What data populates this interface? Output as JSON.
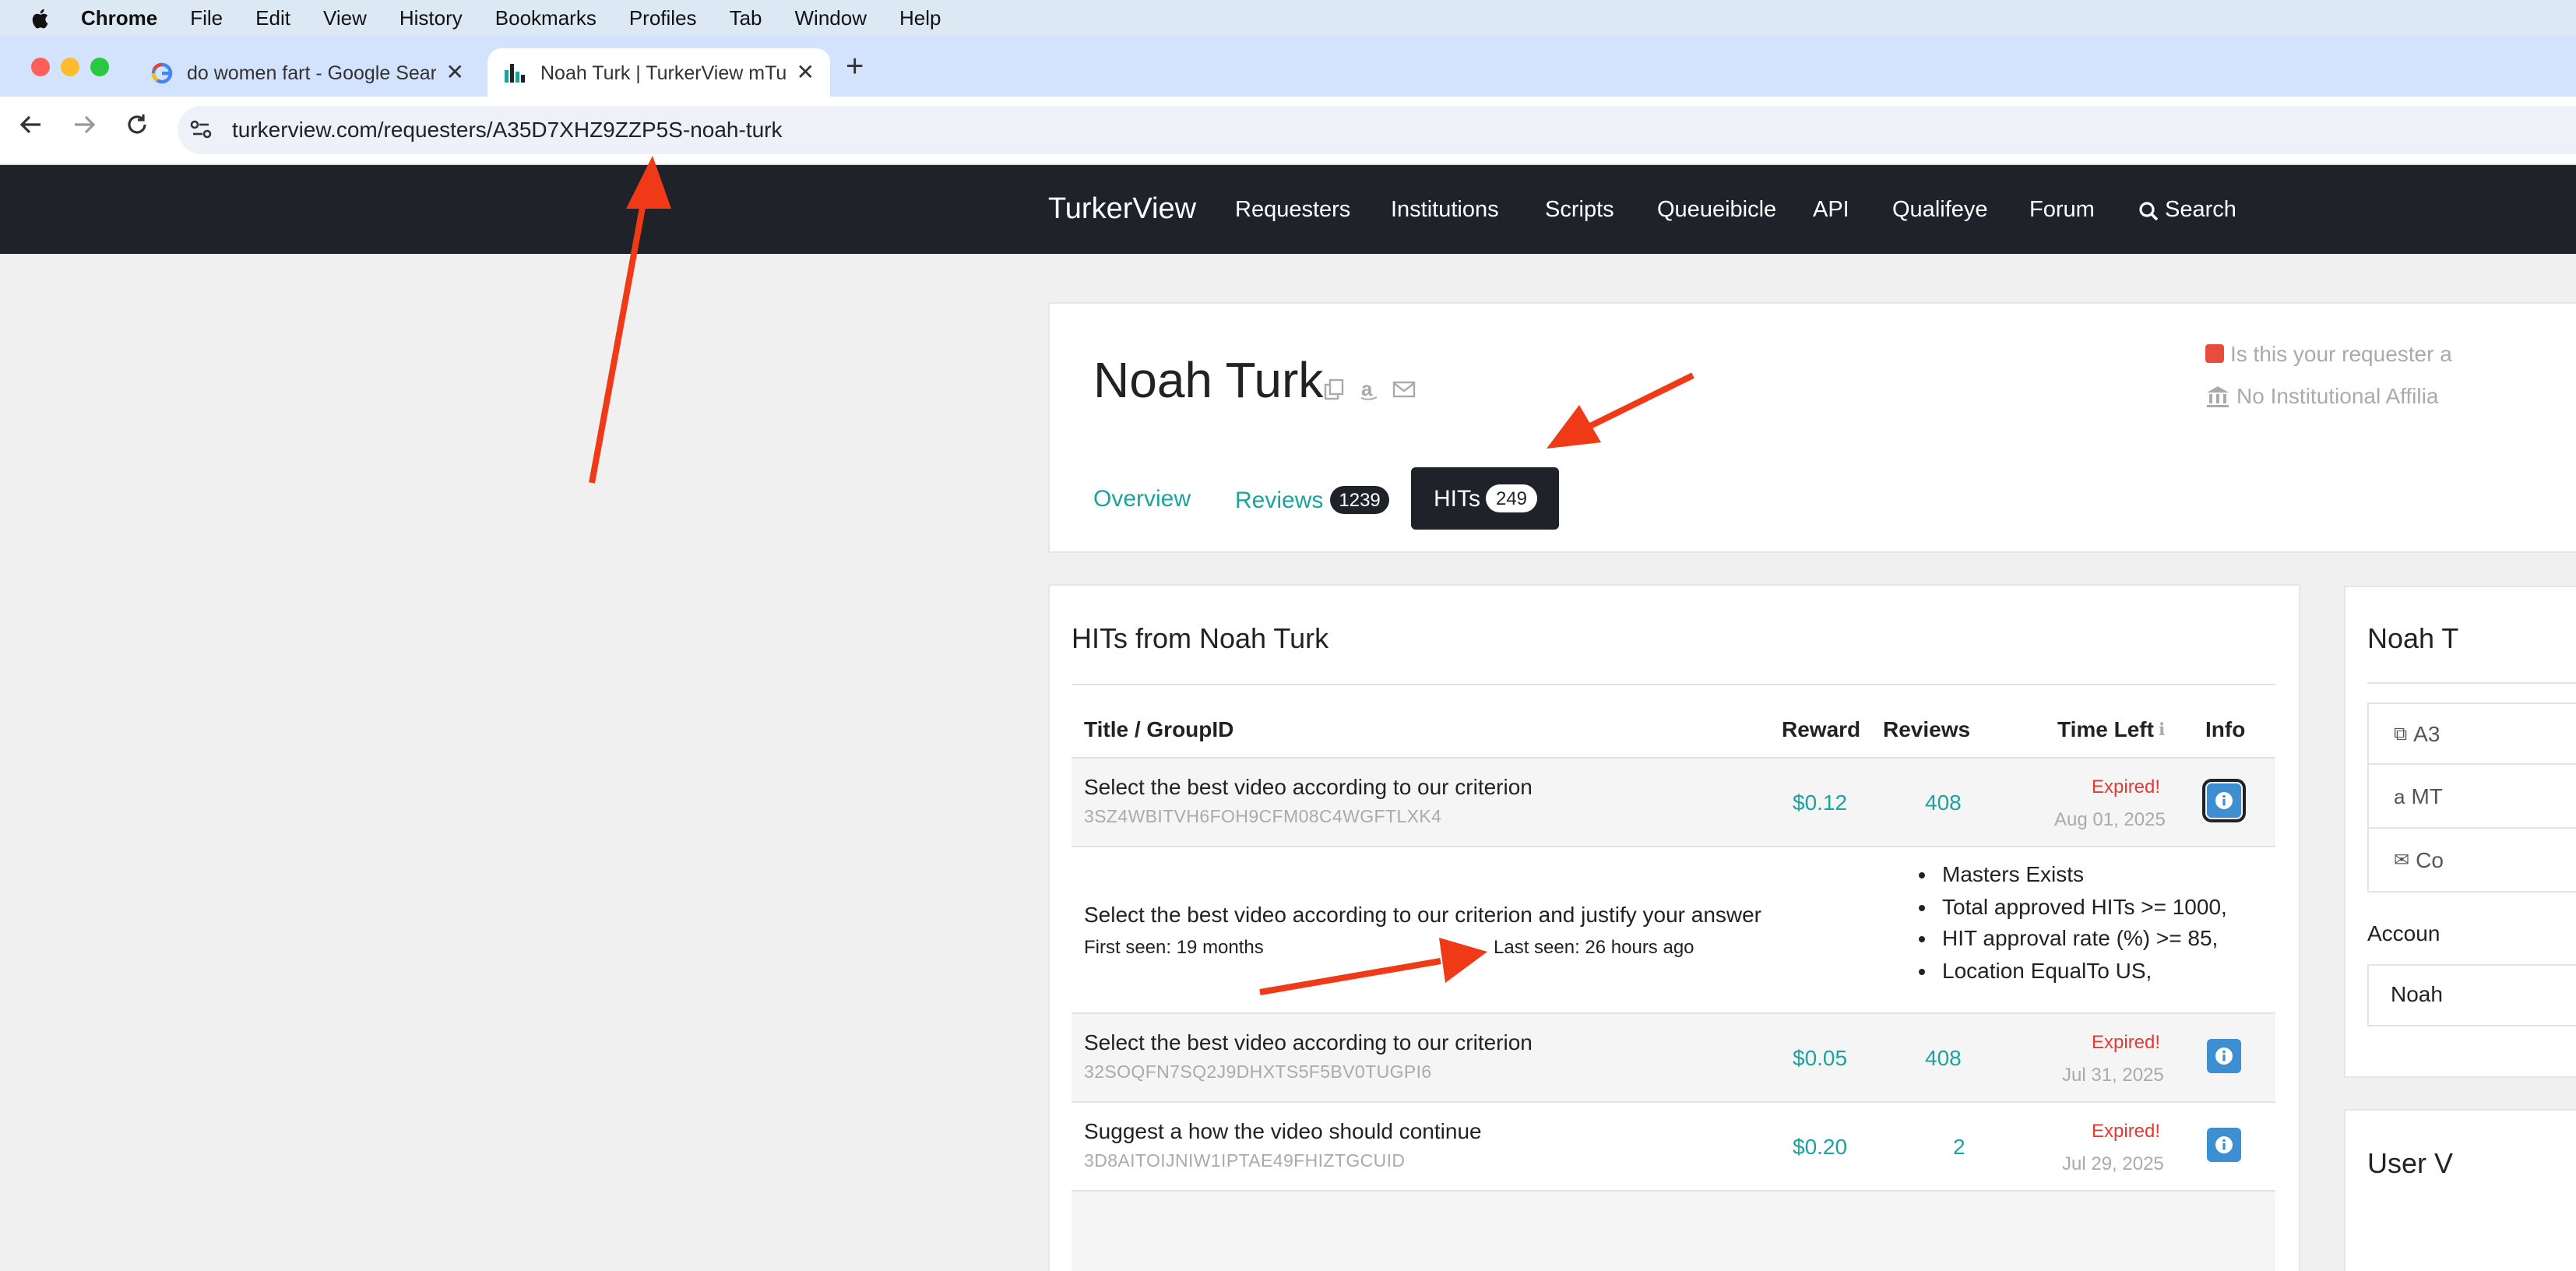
{
  "menubar": {
    "items": [
      "Chrome",
      "File",
      "Edit",
      "View",
      "History",
      "Bookmarks",
      "Profiles",
      "Tab",
      "Window",
      "Help"
    ]
  },
  "tabs": [
    {
      "label": "do women fart - Google Searc",
      "icon": "google-g-icon",
      "active": false
    },
    {
      "label": "Noah Turk | TurkerView mTurk",
      "icon": "turkerview-bars-icon",
      "active": true
    }
  ],
  "address_bar": {
    "url": "turkerview.com/requesters/A35D7XHZ9ZZP5S-noah-turk"
  },
  "site_nav": {
    "brand": "TurkerView",
    "links": [
      "Requesters",
      "Institutions",
      "Scripts",
      "Queueibicle",
      "API",
      "Qualifeye",
      "Forum",
      "Search"
    ]
  },
  "profile": {
    "name": "Noah Turk",
    "notes": [
      "Is this your requester a",
      "No Institutional Affilia"
    ],
    "tabs": [
      {
        "label": "Overview"
      },
      {
        "label": "Reviews",
        "count": "1239"
      },
      {
        "label": "HITs",
        "count": "249",
        "active": true
      }
    ]
  },
  "hits": {
    "title": "HITs from Noah Turk",
    "columns": [
      "Title / GroupID",
      "Reward",
      "Reviews",
      "Time Left",
      "Info"
    ],
    "rows": [
      {
        "title": "Select the best video according to our criterion",
        "group_id": "3SZ4WBITVH6FOH9CFM08C4WGFTLXK4",
        "reward": "$0.12",
        "reviews": "408",
        "status": "Expired!",
        "date": "Aug 01, 2025"
      },
      {
        "title": "Select the best video according to our criterion and justify your answer",
        "first_seen": "First seen: 19 months",
        "last_seen": "Last seen: 26 hours ago",
        "quals": [
          "Masters Exists",
          "Total approved HITs >= 1000,",
          "HIT approval rate (%) >= 85,",
          "Location EqualTo US,"
        ]
      },
      {
        "title": "Select the best video according to our criterion",
        "group_id": "32SOQFN7SQ2J9DHXTS5F5BV0TUGPI6",
        "reward": "$0.05",
        "reviews": "408",
        "status": "Expired!",
        "date": "Jul 31, 2025"
      },
      {
        "title": "Suggest a how the video should continue",
        "group_id": "3D8AITOIJNIW1IPTAE49FHIZTGCUID",
        "reward": "$0.20",
        "reviews": "2",
        "status": "Expired!",
        "date": "Jul 29, 2025"
      }
    ]
  },
  "sidebar": {
    "title": "Noah T",
    "items": [
      "A3",
      "MT",
      "Co"
    ],
    "account_label": "Accoun",
    "account_value": "Noah",
    "user_heading": "User V"
  },
  "colors": {
    "accent": "#1ba39c",
    "dark": "#1f2329",
    "expired": "#e53935",
    "info_button": "#3d8fd1",
    "annotation_arrow": "#f03a17"
  }
}
